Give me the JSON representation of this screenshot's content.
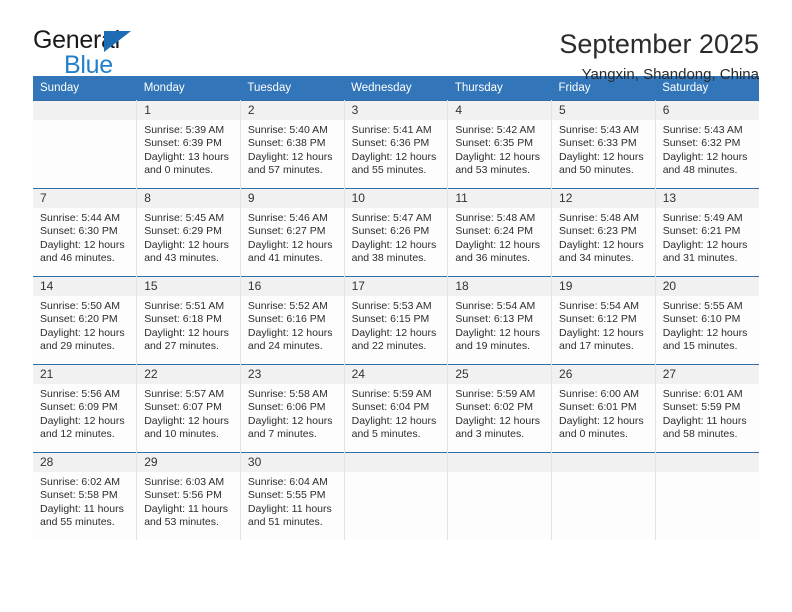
{
  "brand": {
    "name_top": "General",
    "name_bottom": "Blue",
    "triangle_color": "#1e6cb5",
    "blue_color": "#2380c8"
  },
  "header": {
    "title": "September 2025",
    "subtitle": "Yangxin, Shandong, China"
  },
  "theme": {
    "header_bar": "#3275b8",
    "row_divider": "#2f6da8",
    "daynum_bg": "#f1f1f1"
  },
  "weekday_headers": [
    "Sunday",
    "Monday",
    "Tuesday",
    "Wednesday",
    "Thursday",
    "Friday",
    "Saturday"
  ],
  "labels": {
    "sunrise_prefix": "Sunrise:",
    "sunset_prefix": "Sunset:",
    "daylight_prefix": "Daylight:"
  },
  "weeks": [
    [
      {
        "day": "",
        "empty": true
      },
      {
        "day": "1",
        "sunrise": "Sunrise: 5:39 AM",
        "sunset": "Sunset: 6:39 PM",
        "daylight": "Daylight: 13 hours and 0 minutes."
      },
      {
        "day": "2",
        "sunrise": "Sunrise: 5:40 AM",
        "sunset": "Sunset: 6:38 PM",
        "daylight": "Daylight: 12 hours and 57 minutes."
      },
      {
        "day": "3",
        "sunrise": "Sunrise: 5:41 AM",
        "sunset": "Sunset: 6:36 PM",
        "daylight": "Daylight: 12 hours and 55 minutes."
      },
      {
        "day": "4",
        "sunrise": "Sunrise: 5:42 AM",
        "sunset": "Sunset: 6:35 PM",
        "daylight": "Daylight: 12 hours and 53 minutes."
      },
      {
        "day": "5",
        "sunrise": "Sunrise: 5:43 AM",
        "sunset": "Sunset: 6:33 PM",
        "daylight": "Daylight: 12 hours and 50 minutes."
      },
      {
        "day": "6",
        "sunrise": "Sunrise: 5:43 AM",
        "sunset": "Sunset: 6:32 PM",
        "daylight": "Daylight: 12 hours and 48 minutes."
      }
    ],
    [
      {
        "day": "7",
        "sunrise": "Sunrise: 5:44 AM",
        "sunset": "Sunset: 6:30 PM",
        "daylight": "Daylight: 12 hours and 46 minutes."
      },
      {
        "day": "8",
        "sunrise": "Sunrise: 5:45 AM",
        "sunset": "Sunset: 6:29 PM",
        "daylight": "Daylight: 12 hours and 43 minutes."
      },
      {
        "day": "9",
        "sunrise": "Sunrise: 5:46 AM",
        "sunset": "Sunset: 6:27 PM",
        "daylight": "Daylight: 12 hours and 41 minutes."
      },
      {
        "day": "10",
        "sunrise": "Sunrise: 5:47 AM",
        "sunset": "Sunset: 6:26 PM",
        "daylight": "Daylight: 12 hours and 38 minutes."
      },
      {
        "day": "11",
        "sunrise": "Sunrise: 5:48 AM",
        "sunset": "Sunset: 6:24 PM",
        "daylight": "Daylight: 12 hours and 36 minutes."
      },
      {
        "day": "12",
        "sunrise": "Sunrise: 5:48 AM",
        "sunset": "Sunset: 6:23 PM",
        "daylight": "Daylight: 12 hours and 34 minutes."
      },
      {
        "day": "13",
        "sunrise": "Sunrise: 5:49 AM",
        "sunset": "Sunset: 6:21 PM",
        "daylight": "Daylight: 12 hours and 31 minutes."
      }
    ],
    [
      {
        "day": "14",
        "sunrise": "Sunrise: 5:50 AM",
        "sunset": "Sunset: 6:20 PM",
        "daylight": "Daylight: 12 hours and 29 minutes."
      },
      {
        "day": "15",
        "sunrise": "Sunrise: 5:51 AM",
        "sunset": "Sunset: 6:18 PM",
        "daylight": "Daylight: 12 hours and 27 minutes."
      },
      {
        "day": "16",
        "sunrise": "Sunrise: 5:52 AM",
        "sunset": "Sunset: 6:16 PM",
        "daylight": "Daylight: 12 hours and 24 minutes."
      },
      {
        "day": "17",
        "sunrise": "Sunrise: 5:53 AM",
        "sunset": "Sunset: 6:15 PM",
        "daylight": "Daylight: 12 hours and 22 minutes."
      },
      {
        "day": "18",
        "sunrise": "Sunrise: 5:54 AM",
        "sunset": "Sunset: 6:13 PM",
        "daylight": "Daylight: 12 hours and 19 minutes."
      },
      {
        "day": "19",
        "sunrise": "Sunrise: 5:54 AM",
        "sunset": "Sunset: 6:12 PM",
        "daylight": "Daylight: 12 hours and 17 minutes."
      },
      {
        "day": "20",
        "sunrise": "Sunrise: 5:55 AM",
        "sunset": "Sunset: 6:10 PM",
        "daylight": "Daylight: 12 hours and 15 minutes."
      }
    ],
    [
      {
        "day": "21",
        "sunrise": "Sunrise: 5:56 AM",
        "sunset": "Sunset: 6:09 PM",
        "daylight": "Daylight: 12 hours and 12 minutes."
      },
      {
        "day": "22",
        "sunrise": "Sunrise: 5:57 AM",
        "sunset": "Sunset: 6:07 PM",
        "daylight": "Daylight: 12 hours and 10 minutes."
      },
      {
        "day": "23",
        "sunrise": "Sunrise: 5:58 AM",
        "sunset": "Sunset: 6:06 PM",
        "daylight": "Daylight: 12 hours and 7 minutes."
      },
      {
        "day": "24",
        "sunrise": "Sunrise: 5:59 AM",
        "sunset": "Sunset: 6:04 PM",
        "daylight": "Daylight: 12 hours and 5 minutes."
      },
      {
        "day": "25",
        "sunrise": "Sunrise: 5:59 AM",
        "sunset": "Sunset: 6:02 PM",
        "daylight": "Daylight: 12 hours and 3 minutes."
      },
      {
        "day": "26",
        "sunrise": "Sunrise: 6:00 AM",
        "sunset": "Sunset: 6:01 PM",
        "daylight": "Daylight: 12 hours and 0 minutes."
      },
      {
        "day": "27",
        "sunrise": "Sunrise: 6:01 AM",
        "sunset": "Sunset: 5:59 PM",
        "daylight": "Daylight: 11 hours and 58 minutes."
      }
    ],
    [
      {
        "day": "28",
        "sunrise": "Sunrise: 6:02 AM",
        "sunset": "Sunset: 5:58 PM",
        "daylight": "Daylight: 11 hours and 55 minutes."
      },
      {
        "day": "29",
        "sunrise": "Sunrise: 6:03 AM",
        "sunset": "Sunset: 5:56 PM",
        "daylight": "Daylight: 11 hours and 53 minutes."
      },
      {
        "day": "30",
        "sunrise": "Sunrise: 6:04 AM",
        "sunset": "Sunset: 5:55 PM",
        "daylight": "Daylight: 11 hours and 51 minutes."
      },
      {
        "day": "",
        "empty": true
      },
      {
        "day": "",
        "empty": true
      },
      {
        "day": "",
        "empty": true
      },
      {
        "day": "",
        "empty": true
      }
    ]
  ]
}
